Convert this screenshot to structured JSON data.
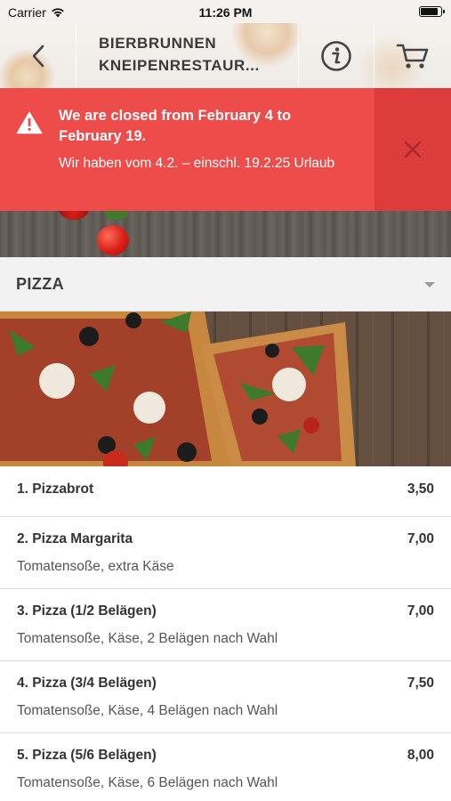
{
  "status_bar": {
    "carrier": "Carrier",
    "time": "11:26 PM"
  },
  "header": {
    "title_line1": "BIERBRUNNEN",
    "title_line2": "KNEIPENRESTAUR...",
    "icons": [
      "back-chevron-icon",
      "info-icon",
      "cart-icon"
    ]
  },
  "alert": {
    "title": "We are closed from February 4 to February 19.",
    "message": "Wir haben vom 4.2. – einschl. 19.2.25 Urlaub",
    "color": "#ee4b4b"
  },
  "category": {
    "title": "PIZZA"
  },
  "menu": {
    "items": [
      {
        "name": "1. Pizzabrot",
        "price": "3,50",
        "description": ""
      },
      {
        "name": "2. Pizza Margarita",
        "price": "7,00",
        "description": "Tomatensoße, extra Käse"
      },
      {
        "name": "3. Pizza (1/2 Belägen)",
        "price": "7,00",
        "description": "Tomatensoße, Käse, 2 Belägen nach Wahl"
      },
      {
        "name": "4. Pizza (3/4 Belägen)",
        "price": "7,50",
        "description": "Tomatensoße, Käse, 4 Belägen nach Wahl"
      },
      {
        "name": "5. Pizza (5/6 Belägen)",
        "price": "8,00",
        "description": "Tomatensoße, Käse, 6 Belägen nach Wahl"
      }
    ]
  }
}
